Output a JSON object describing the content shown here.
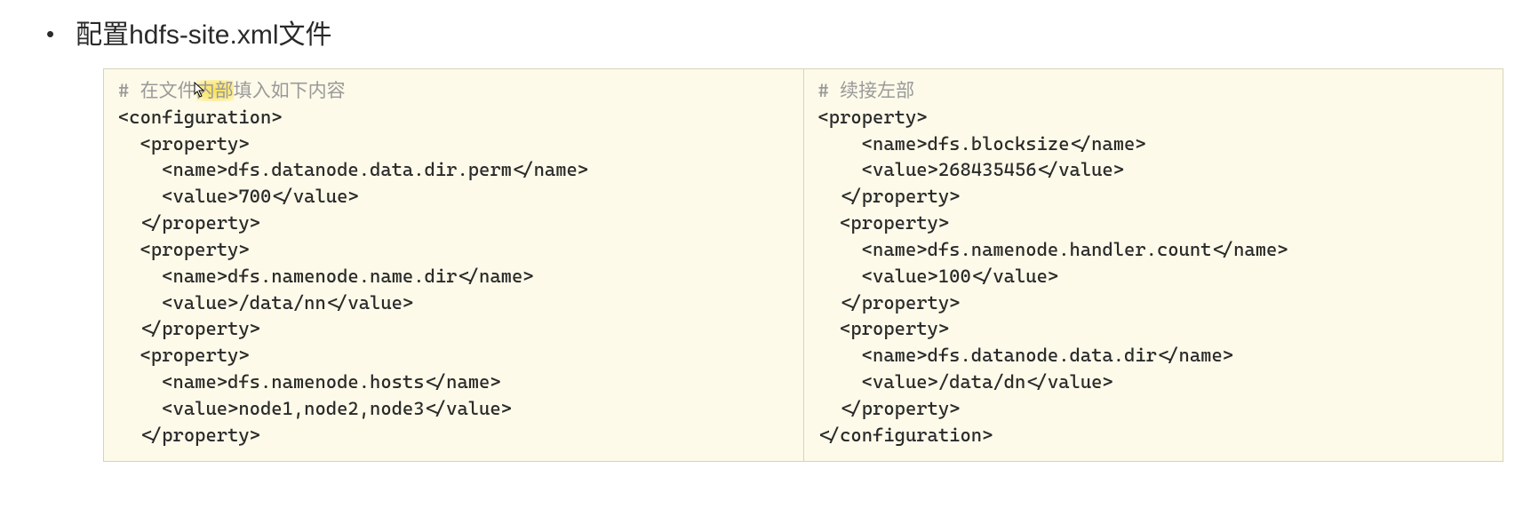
{
  "title": "配置hdfs-site.xml文件",
  "left_panel": {
    "comment": "# 在文件内部填入如下内容",
    "lines": [
      "<configuration>",
      "  <property>",
      "    <name>dfs.datanode.data.dir.perm</name>",
      "    <value>700</value>",
      "  </property>",
      "  <property>",
      "    <name>dfs.namenode.name.dir</name>",
      "    <value>/data/nn</value>",
      "  </property>",
      "  <property>",
      "    <name>dfs.namenode.hosts</name>",
      "    <value>node1,node2,node3</value>",
      "  </property>"
    ]
  },
  "right_panel": {
    "comment": "# 续接左部",
    "lines": [
      "<property>",
      "    <name>dfs.blocksize</name>",
      "    <value>268435456</value>",
      "  </property>",
      "  <property>",
      "    <name>dfs.namenode.handler.count</name>",
      "    <value>100</value>",
      "  </property>",
      "  <property>",
      "    <name>dfs.datanode.data.dir</name>",
      "    <value>/data/dn</value>",
      "  </property>",
      "</configuration>"
    ]
  },
  "highlight_segment": "内部",
  "comment_prefix": "# 在文件",
  "comment_suffix": "填入如下内容"
}
